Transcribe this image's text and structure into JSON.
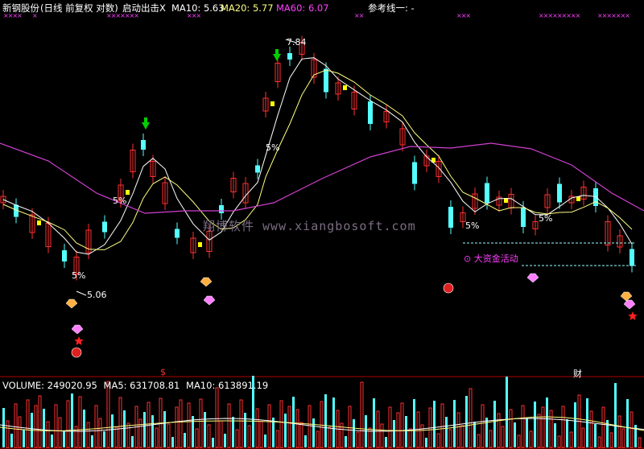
{
  "header": {
    "stock": "新钢股份",
    "period": "(日线 前复权 对数)",
    "indicator": "启动出击X",
    "ma10": "MA10: 5.63",
    "ma20": "MA20: 5.77",
    "ma60": "MA60: 6.07",
    "ref": "参考线一: -"
  },
  "top_marks": [
    "××××",
    "×",
    "×××××××",
    "×××",
    "××",
    "×××",
    "×××××××××",
    "×××××××"
  ],
  "annotations": {
    "high_price": "7.84",
    "low_price": "5.06",
    "pct_labels": [
      "5%",
      "5%",
      "5%",
      "5%",
      "5%"
    ],
    "big_fund": "⊙ 大资金活动",
    "dollar_marker": "$",
    "cai_marker": "财"
  },
  "watermark": "翔博软件 www.xiangbosoft.com",
  "volume_header": {
    "volume": "VOLUME: 249020.95",
    "ma5": "MA5: 631708.81",
    "ma10": "MA10: 613891.19"
  },
  "colors": {
    "up": "#ff3030",
    "down": "#54ffff",
    "ma10": "#ffffff",
    "ma20": "#ffff80",
    "ma60": "#d040d0",
    "header_text": "#ffffff",
    "ma60_text": "#ff40ff",
    "ref_text": "#ffffff",
    "signal": "#ffff00"
  },
  "icons": [
    "green-down-arrow-icon",
    "gem-icon",
    "red-star-icon",
    "red-ball-icon"
  ]
}
